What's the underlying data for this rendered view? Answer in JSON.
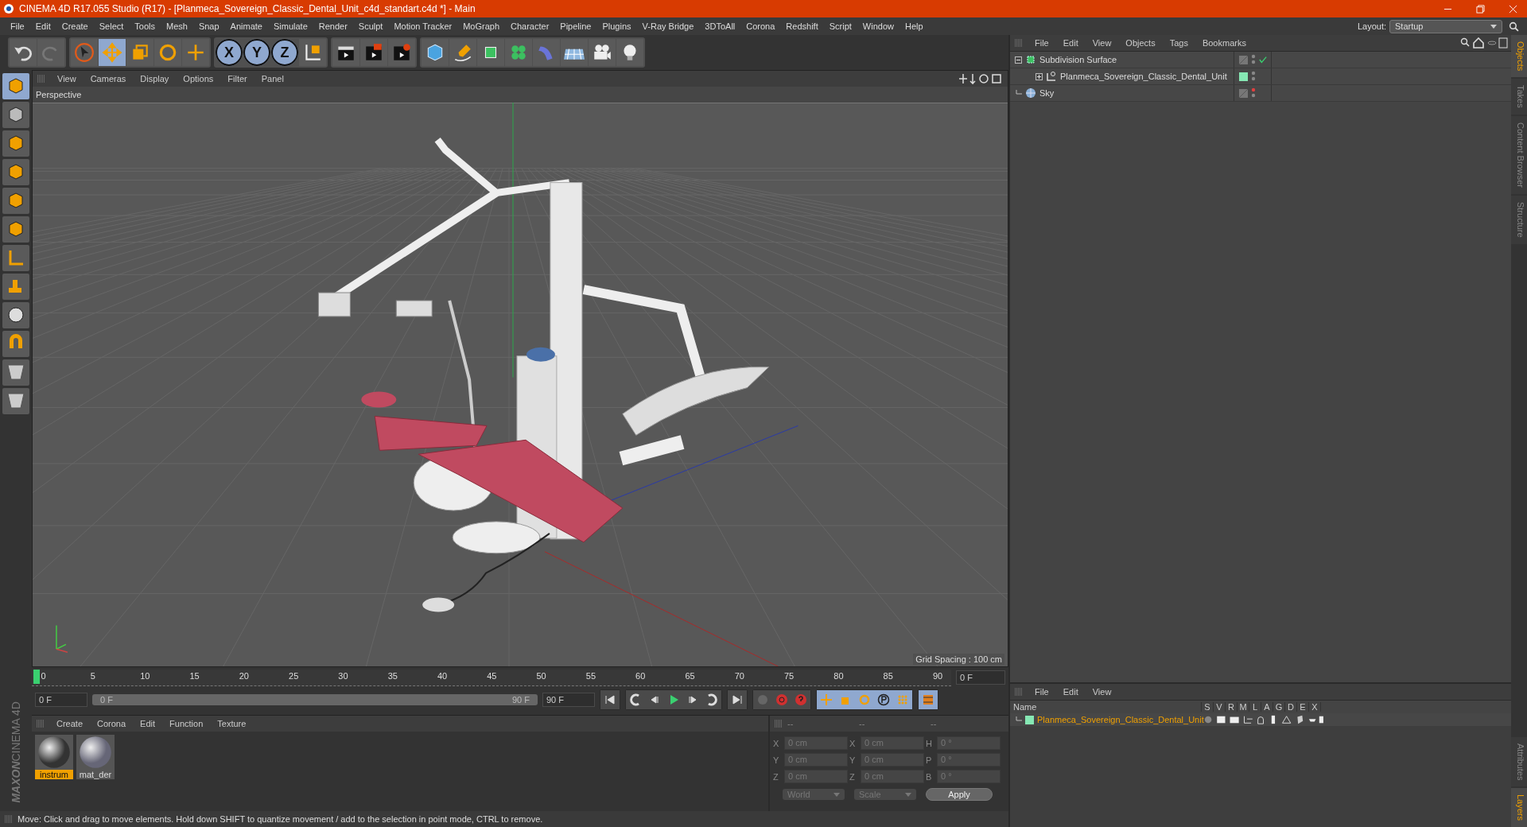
{
  "window": {
    "title": "CINEMA 4D R17.055 Studio (R17) - [Planmeca_Sovereign_Classic_Dental_Unit_c4d_standart.c4d *] - Main"
  },
  "menu": [
    "File",
    "Edit",
    "Create",
    "Select",
    "Tools",
    "Mesh",
    "Snap",
    "Animate",
    "Simulate",
    "Render",
    "Sculpt",
    "Motion Tracker",
    "MoGraph",
    "Character",
    "Pipeline",
    "Plugins",
    "V-Ray Bridge",
    "3DToAll",
    "Corona",
    "Redshift",
    "Script",
    "Window",
    "Help"
  ],
  "layout": {
    "label": "Layout:",
    "value": "Startup"
  },
  "toolbar": {
    "axes": [
      {
        "label": "X",
        "selected": true
      },
      {
        "label": "Y",
        "selected": true
      },
      {
        "label": "Z",
        "selected": true
      }
    ]
  },
  "viewport": {
    "menu": [
      "View",
      "Cameras",
      "Display",
      "Options",
      "Filter",
      "Panel"
    ],
    "camera": "Perspective",
    "grid_spacing": "Grid Spacing : 100 cm"
  },
  "timeline": {
    "ticks": [
      "0",
      "5",
      "10",
      "15",
      "20",
      "25",
      "30",
      "35",
      "40",
      "45",
      "50",
      "55",
      "60",
      "65",
      "70",
      "75",
      "80",
      "85",
      "90"
    ],
    "playhead": {
      "level": 0
    },
    "current_frame": "0 F",
    "start_field": "0 F",
    "range_slider": {
      "start": "0 F",
      "end": "90 F",
      "level": 1
    },
    "end_field": "90 F"
  },
  "materials": {
    "menu": [
      "Create",
      "Corona",
      "Edit",
      "Function",
      "Texture"
    ],
    "items": [
      {
        "name": "instrum",
        "selected": true
      },
      {
        "name": "mat_der",
        "selected": false
      }
    ]
  },
  "coordinates": {
    "disabled": true,
    "headers": [
      "--",
      "--",
      "--"
    ],
    "rows": [
      [
        {
          "axis": "X",
          "value": "0 cm"
        },
        {
          "axis": "X",
          "value": "0 cm"
        },
        {
          "axis": "H",
          "value": "0 °"
        }
      ],
      [
        {
          "axis": "Y",
          "value": "0 cm"
        },
        {
          "axis": "Y",
          "value": "0 cm"
        },
        {
          "axis": "P",
          "value": "0 °"
        }
      ],
      [
        {
          "axis": "Z",
          "value": "0 cm"
        },
        {
          "axis": "Z",
          "value": "0 cm"
        },
        {
          "axis": "B",
          "value": "0 °"
        }
      ]
    ],
    "dropdowns": [
      "World",
      "Scale"
    ],
    "apply": "Apply"
  },
  "objects": {
    "menu": [
      "File",
      "Edit",
      "View",
      "Objects",
      "Tags",
      "Bookmarks"
    ],
    "tree": [
      {
        "name": "Subdivision Surface",
        "kind": "subdivision",
        "checked": true,
        "expanded": true,
        "children": [
          {
            "name": "Planmeca_Sovereign_Classic_Dental_Unit",
            "kind": "null",
            "checked": false,
            "expanded": false,
            "color": "#86e8b4"
          }
        ]
      },
      {
        "name": "Sky",
        "kind": "sky",
        "checked": false
      }
    ]
  },
  "side_tabs_top": [
    {
      "label": "Objects",
      "selected": true
    },
    {
      "label": "Takes",
      "selected": false
    },
    {
      "label": "Content Browser",
      "selected": false
    },
    {
      "label": "Structure",
      "selected": false
    }
  ],
  "layers": {
    "menu": [
      "File",
      "Edit",
      "View"
    ],
    "columns": [
      "Name",
      "S",
      "V",
      "R",
      "M",
      "L",
      "A",
      "G",
      "D",
      "E",
      "X"
    ],
    "rows": [
      {
        "name": "Planmeca_Sovereign_Classic_Dental_Unit",
        "color": "#86e8b4"
      }
    ]
  },
  "side_tabs_bottom": [
    {
      "label": "Attributes",
      "selected": false
    },
    {
      "label": "Layers",
      "selected": true
    }
  ],
  "logo": [
    "MAXON",
    "CINEMA 4D"
  ],
  "status": "Move: Click and drag to move elements. Hold down SHIFT to quantize movement / add to the selection in point mode, CTRL to remove."
}
